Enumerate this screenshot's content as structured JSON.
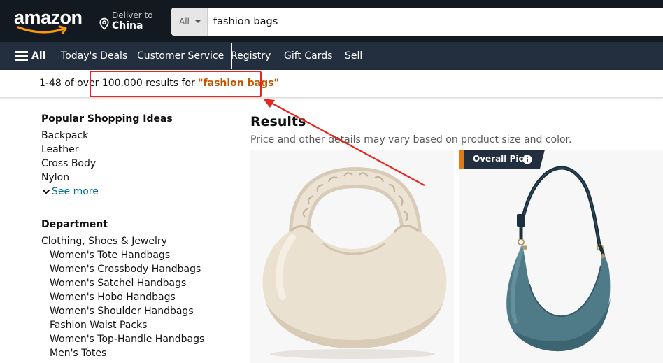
{
  "header": {
    "logo_text": "amazon",
    "deliver_to_label": "Deliver to",
    "deliver_to_location": "China",
    "search_category": "All",
    "search_value": "fashion bags"
  },
  "nav": {
    "all_label": "All",
    "items": [
      "Today's Deals",
      "Customer Service",
      "Registry",
      "Gift Cards",
      "Sell"
    ]
  },
  "results_bar": {
    "prefix": "1-48 of over 100,000 results for ",
    "query": "\"fashion bags\""
  },
  "sidebar": {
    "popular_heading": "Popular Shopping Ideas",
    "popular_items": [
      "Backpack",
      "Leather",
      "Cross Body",
      "Nylon"
    ],
    "see_more": "See more",
    "department_heading": "Department",
    "department_root": "Clothing, Shoes & Jewelry",
    "department_items": [
      "Women's Tote Handbags",
      "Women's Crossbody Handbags",
      "Women's Satchel Handbags",
      "Women's Hobo Handbags",
      "Women's Shoulder Handbags",
      "Fashion Waist Packs",
      "Women's Top-Handle Handbags",
      "Men's Totes"
    ]
  },
  "main": {
    "title": "Results",
    "subtitle": "Price and other details may vary based on product size and color.",
    "badge_label": "Overall Pick"
  },
  "colors": {
    "header_bg": "#131921",
    "nav_bg": "#232f3e",
    "query_orange": "#c45500",
    "link_teal": "#007185",
    "annotation_red": "#e6261c",
    "badge_orange": "#e47911"
  }
}
